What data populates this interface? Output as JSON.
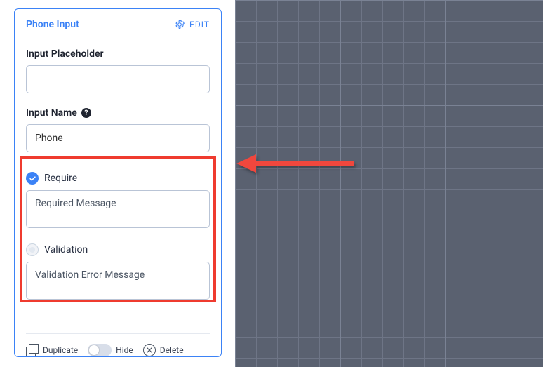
{
  "panel": {
    "title": "Phone Input",
    "edit_label": "EDIT"
  },
  "fields": {
    "placeholder_label": "Input Placeholder",
    "placeholder_value": "",
    "name_label": "Input Name",
    "name_value": "Phone"
  },
  "options": {
    "require_label": "Require",
    "require_checked": true,
    "required_message": "Required Message",
    "validation_label": "Validation",
    "validation_checked": false,
    "validation_message": "Validation Error Message"
  },
  "footer": {
    "duplicate": "Duplicate",
    "hide": "Hide",
    "delete": "Delete"
  },
  "colors": {
    "accent": "#3b82f6",
    "highlight": "#ef3b2f",
    "arrow": "#f0473d"
  }
}
